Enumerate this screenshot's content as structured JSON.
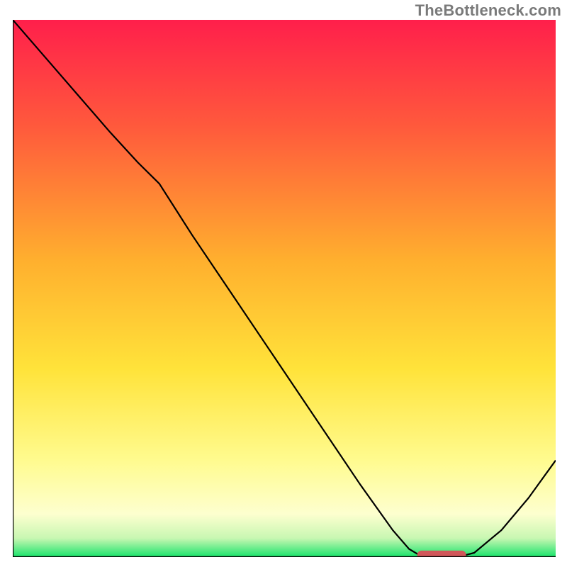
{
  "chart_data": {
    "type": "line",
    "title": "",
    "xlabel": "",
    "ylabel": "",
    "xlim": [
      0,
      100
    ],
    "ylim": [
      0,
      100
    ],
    "grid": false,
    "watermark": "TheBottleneck.com",
    "gradient_stops": [
      {
        "offset": 0.0,
        "color": "#ff1f4b"
      },
      {
        "offset": 0.2,
        "color": "#ff5a3c"
      },
      {
        "offset": 0.45,
        "color": "#ffb02e"
      },
      {
        "offset": 0.65,
        "color": "#ffe33a"
      },
      {
        "offset": 0.82,
        "color": "#fffb8f"
      },
      {
        "offset": 0.92,
        "color": "#fdffcf"
      },
      {
        "offset": 0.965,
        "color": "#c8f7b2"
      },
      {
        "offset": 1.0,
        "color": "#17e36a"
      }
    ],
    "series": [
      {
        "name": "curve",
        "color": "#000000",
        "stroke_width": 2.2,
        "x": [
          0.0,
          6.0,
          12.0,
          18.0,
          23.0,
          27.0,
          33.0,
          40.0,
          48.0,
          56.0,
          64.0,
          70.0,
          73.0,
          75.0,
          78.0,
          82.0,
          85.0,
          90.0,
          95.0,
          100.0
        ],
        "y": [
          100.0,
          93.0,
          86.0,
          79.0,
          73.5,
          69.5,
          60.0,
          49.5,
          37.5,
          25.5,
          13.5,
          5.0,
          1.5,
          0.3,
          0.0,
          0.0,
          0.8,
          5.0,
          11.0,
          18.0
        ]
      }
    ],
    "marker": {
      "name": "optimum-marker",
      "color": "#d1575a",
      "x_start": 74.5,
      "x_end": 83.5,
      "y": 0.4,
      "thickness": 1.6
    },
    "axes": {
      "color": "#000000",
      "width": 2.4
    }
  }
}
